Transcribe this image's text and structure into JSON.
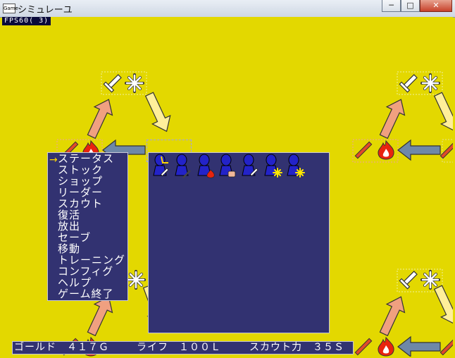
{
  "window": {
    "title": "シミュレーユ",
    "icon_label": "Game",
    "buttons": {
      "minimize": "─",
      "maximize": "□",
      "close": "✕"
    }
  },
  "fps": "FPS60( 3)",
  "menu": {
    "items": [
      "ステータス",
      "ストック",
      "ショップ",
      "リーダー",
      "スカウト",
      "復活",
      "放出",
      "セーブ",
      "移動",
      "トレーニング",
      "コンフィグ",
      "ヘルプ",
      "ゲーム終了"
    ],
    "selected_index": 0,
    "cursor": "→"
  },
  "status": {
    "gold": "ゴールド　４１７Ｇ",
    "life": "ライフ　１００Ｌ",
    "scout": "スカウト力　３５Ｓ"
  },
  "icons": {
    "sword": "sword-icon",
    "spark": "spark-icon",
    "fire": "fire-icon",
    "rod": "rod-icon",
    "fist": "fist-icon",
    "arrow": "arrow-icon"
  },
  "colors": {
    "background": "#e3d800",
    "menu_bg": "#323271",
    "unit_blue": "#2323c8",
    "arrow_salmon": "#f0a080",
    "arrow_steel": "#6e88a8",
    "arrow_cream": "#ffef9a"
  }
}
